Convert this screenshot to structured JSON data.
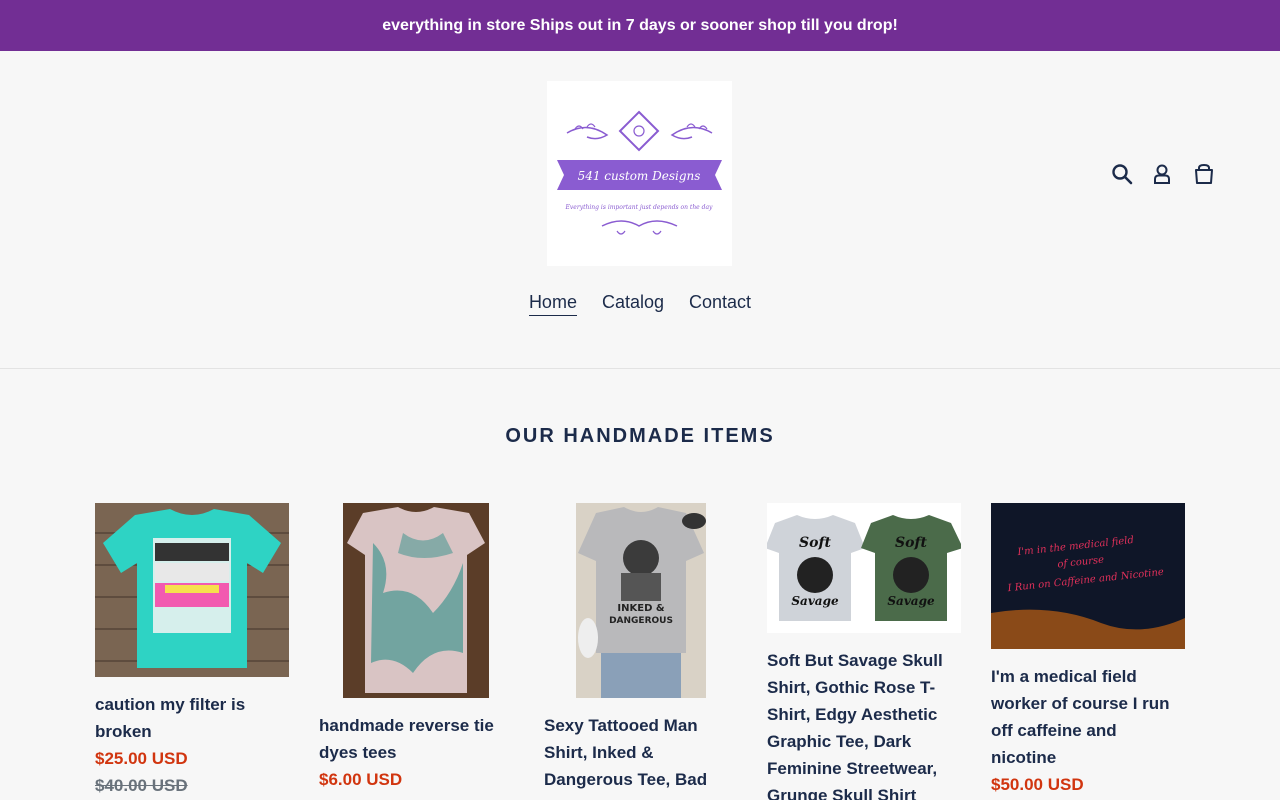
{
  "announcement": "everything in store Ships out in 7 days or sooner shop till you drop!",
  "logo": {
    "brand": "541 custom Designs",
    "tagline": "Everything is important just depends on the day",
    "accent": "#8a5cd1"
  },
  "header": {
    "icons": [
      "search-icon",
      "account-icon",
      "cart-icon"
    ]
  },
  "nav": {
    "items": [
      {
        "label": "Home",
        "active": true
      },
      {
        "label": "Catalog",
        "active": false
      },
      {
        "label": "Contact",
        "active": false
      }
    ]
  },
  "section": {
    "title": "OUR HANDMADE ITEMS"
  },
  "products": [
    {
      "title": "caution my filter is broken",
      "price": "$25.00 USD",
      "compare_price": "$40.00 USD"
    },
    {
      "title": "handmade reverse tie dyes tees",
      "price": "$6.00 USD",
      "compare_price": ""
    },
    {
      "title": "Sexy Tattooed Man Shirt, Inked & Dangerous Tee, Bad",
      "price": "",
      "compare_price": ""
    },
    {
      "title": "Soft But Savage Skull Shirt, Gothic Rose T-Shirt, Edgy Aesthetic Graphic Tee, Dark Feminine Streetwear, Grunge Skull Shirt",
      "price": "",
      "compare_price": ""
    },
    {
      "title": "I'm a medical field worker of course I run off caffeine and nicotine",
      "price": "$50.00 USD",
      "compare_price": ""
    }
  ],
  "colors": {
    "announcement_bg": "#722e94",
    "text": "#1c2b4a",
    "sale_price": "#d1350f"
  }
}
